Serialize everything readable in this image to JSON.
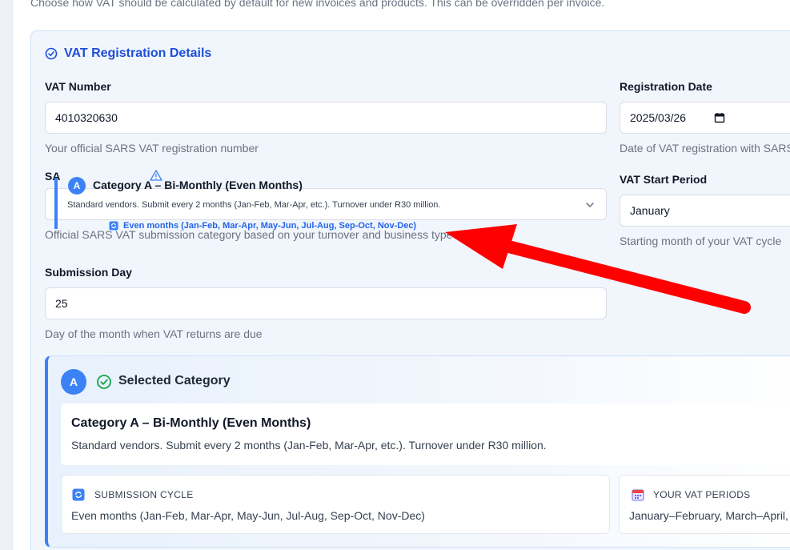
{
  "intro_text": "Choose how VAT should be calculated by default for new invoices and products. This can be overridden per invoice.",
  "section": {
    "title": "VAT Registration Details"
  },
  "fields": {
    "vat_number": {
      "label": "VAT Number",
      "value": "4010320630",
      "helper": "Your official SARS VAT registration number"
    },
    "registration_date": {
      "label": "Registration Date",
      "value": "2025/03/26",
      "helper": "Date of VAT registration with SARS"
    },
    "sars_category": {
      "label": "SA",
      "helper": "Official SARS VAT submission category based on your turnover and business type"
    },
    "vat_start_period": {
      "label": "VAT Start Period",
      "value": "January",
      "helper": "Starting month of your VAT cycle"
    },
    "submission_day": {
      "label": "Submission Day",
      "value": "25",
      "helper": "Day of the month when VAT returns are due"
    }
  },
  "dropdown_option": {
    "badge": "A",
    "title": "Category A – Bi-Monthly (Even Months)",
    "description": "Standard vendors. Submit every 2 months (Jan-Feb, Mar-Apr, etc.). Turnover under R30 million.",
    "cycle": "Even months (Jan-Feb, Mar-Apr, May-Jun, Jul-Aug, Sep-Oct, Nov-Dec)"
  },
  "selected_category": {
    "badge": "A",
    "heading": "Selected Category",
    "title": "Category A – Bi-Monthly (Even Months)",
    "description": "Standard vendors. Submit every 2 months (Jan-Feb, Mar-Apr, etc.). Turnover under R30 million.",
    "submission_cycle": {
      "label": "SUBMISSION CYCLE",
      "value": "Even months (Jan-Feb, Mar-Apr, May-Jun, Jul-Aug, Sep-Oct, Nov-Dec)"
    },
    "vat_periods": {
      "label": "YOUR VAT PERIODS",
      "value": "January–February, March–April, M"
    }
  },
  "colors": {
    "accent": "#3b82f6",
    "title_blue": "#1d4ed8",
    "success_green": "#16a34a",
    "annotation_red": "#ff0000"
  }
}
